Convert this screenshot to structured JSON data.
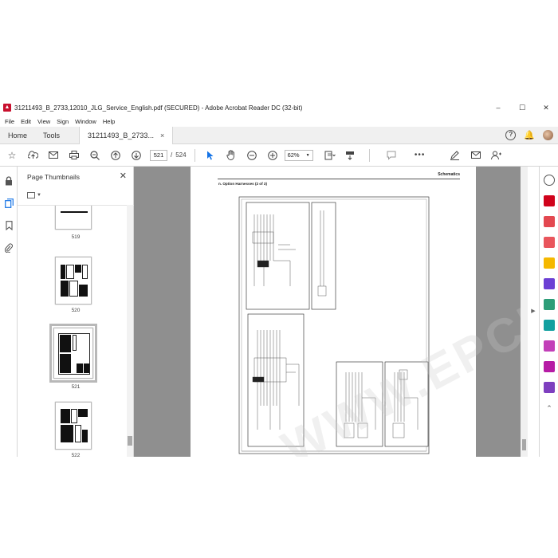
{
  "window": {
    "title": "31211493_B_2733,12010_JLG_Service_English.pdf (SECURED) - Adobe Acrobat Reader DC (32-bit)",
    "minimize": "–",
    "maximize": "☐",
    "close": "✕"
  },
  "menu": [
    "File",
    "Edit",
    "View",
    "Sign",
    "Window",
    "Help"
  ],
  "tabs": {
    "home": "Home",
    "tools": "Tools",
    "document": "31211493_B_2733...",
    "close": "×"
  },
  "toolbar": {
    "current_page": "521",
    "separator": "/",
    "total_pages": "524",
    "zoom": "62%"
  },
  "panel": {
    "title": "Page Thumbnails",
    "close": "✕",
    "thumbnails": [
      {
        "label": "519"
      },
      {
        "label": "520"
      },
      {
        "label": "521",
        "selected": true
      },
      {
        "label": "522"
      }
    ]
  },
  "page": {
    "header": "Schematics",
    "section": "n. Option Harnesses (2 of 3)"
  },
  "watermark": "WWW.EPCDEPO.COM",
  "colors": {
    "accent": "#1473e6",
    "pdf_red": "#c8102e",
    "doc_bg": "#8f8f8f"
  },
  "icons": [
    "pdf-icon",
    "help-icon",
    "bell-icon",
    "avatar",
    "star-icon",
    "upload-icon",
    "print-icon",
    "zoom-out-icon",
    "prev-page-icon",
    "next-page-icon",
    "select-cursor-icon",
    "hand-icon",
    "minus-icon",
    "plus-icon",
    "fit-icon",
    "scroll-mode-icon",
    "comment-icon",
    "more-icon",
    "sign-icon",
    "mail-icon",
    "add-user-icon",
    "lock-icon",
    "thumbnails-icon",
    "bookmark-icon",
    "attachment-icon"
  ]
}
